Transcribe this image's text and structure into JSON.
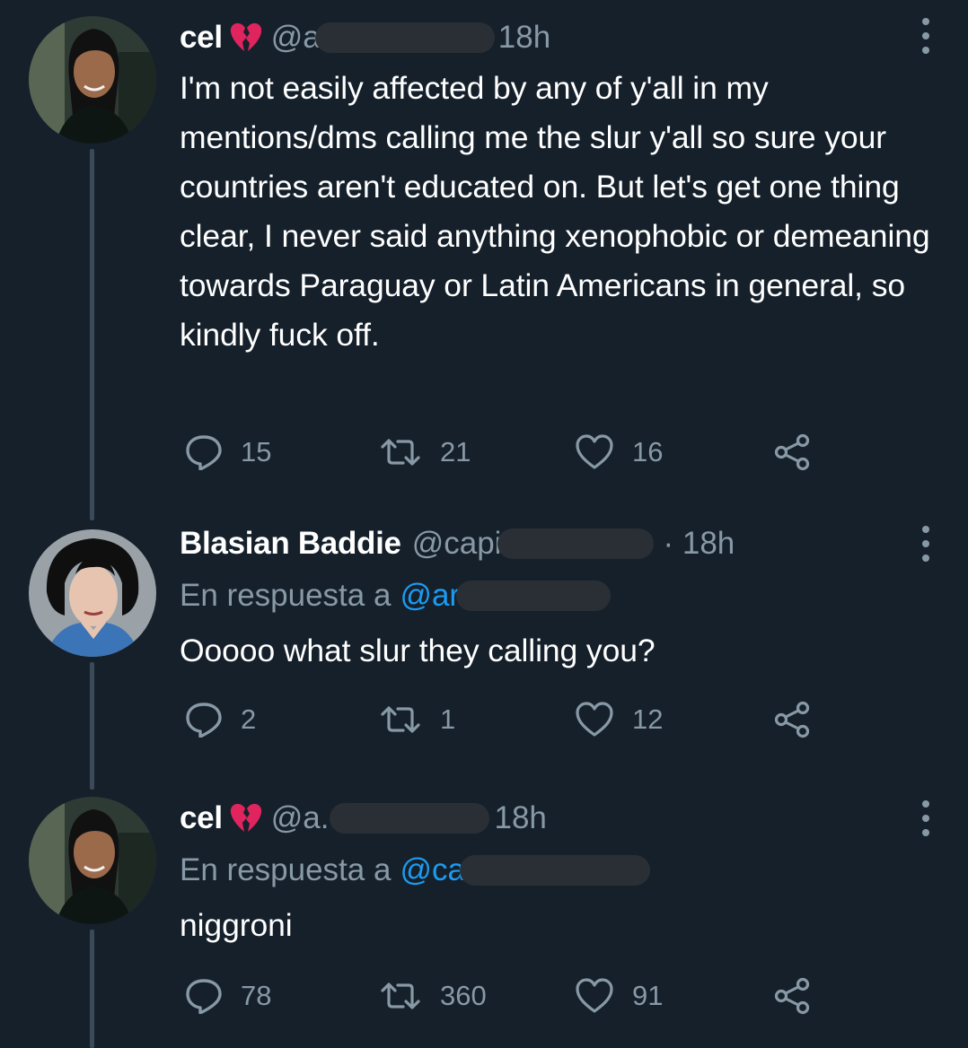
{
  "tweets": [
    {
      "name": "cel",
      "handle": "@a",
      "time": "18h",
      "reply_label": "",
      "reply_mention": "",
      "text": "I'm not easily affected by any of y'all in my mentions/dms calling me the slur y'all so sure your countries aren't educated on. But let's get one thing clear, I never said anything xenophobic or demeaning towards Paraguay or Latin Americans in general, so kindly fuck off.",
      "replies": "15",
      "retweets": "21",
      "likes": "16"
    },
    {
      "name": "Blasian Baddie",
      "handle": "@capi",
      "time": "· 18h",
      "reply_label": "En respuesta a",
      "reply_mention": "@ar",
      "text": "Ooooo what slur they calling you?",
      "replies": "2",
      "retweets": "1",
      "likes": "12"
    },
    {
      "name": "cel",
      "handle": "@a.",
      "time": "18h",
      "reply_label": "En respuesta a",
      "reply_mention": "@ca",
      "text": "niggroni",
      "replies": "78",
      "retweets": "360",
      "likes": "91"
    }
  ],
  "icons": {
    "name_emoji": "broken-heart-icon",
    "reply": "reply-icon",
    "retweet": "retweet-icon",
    "like": "like-icon",
    "share": "share-icon",
    "more": "more-icon"
  },
  "colors": {
    "background": "#15202b",
    "text": "#ffffff",
    "muted": "#8899a6",
    "link": "#1d9bf0",
    "broken_heart": "#e0245e",
    "redaction": "#2a2f35"
  }
}
